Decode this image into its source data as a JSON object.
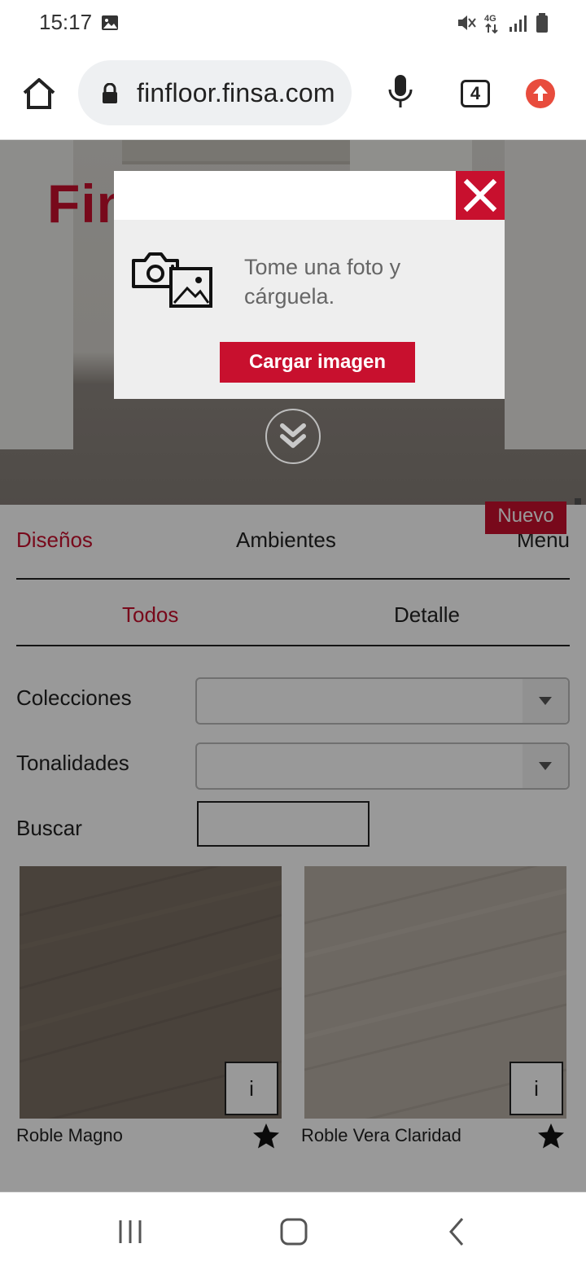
{
  "status_bar": {
    "time": "15:17",
    "icons": [
      "image-icon",
      "mute-icon",
      "4g-icon",
      "signal-icon",
      "battery-icon"
    ],
    "network": "4G"
  },
  "browser": {
    "url": "finfloor.finsa.com",
    "tab_count": "4"
  },
  "hero": {
    "logo_text": "Fin"
  },
  "modal": {
    "message": "Tome una foto y cárguela.",
    "button_label": "Cargar imagen"
  },
  "nav": {
    "tabs": [
      {
        "label": "Diseños"
      },
      {
        "label": "Ambientes"
      },
      {
        "label": "Menu"
      }
    ],
    "sub_tabs": [
      {
        "label": "Todos"
      },
      {
        "label": "Detalle"
      }
    ]
  },
  "filters": {
    "collections_label": "Colecciones",
    "collections_value": "",
    "tones_label": "Tonalidades",
    "tones_value": "",
    "search_label": "Buscar",
    "search_value": ""
  },
  "products": [
    {
      "name": "Roble Magno",
      "info_label": "i",
      "badge": ""
    },
    {
      "name": "Roble Vera Claridad",
      "info_label": "i",
      "badge": "Nuevo"
    }
  ],
  "colors": {
    "accent": "#c8102e",
    "wood_dark": "#7a6e63",
    "wood_light": "#b6ada4"
  }
}
